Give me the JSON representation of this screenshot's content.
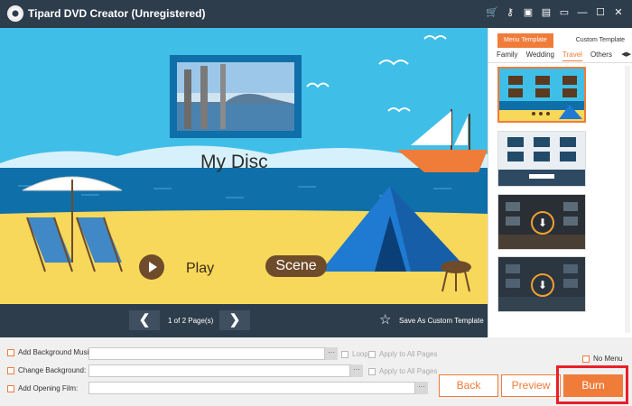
{
  "window": {
    "title": "Tipard DVD Creator (Unregistered)",
    "icons": [
      "cart-icon",
      "key-icon",
      "save-icon",
      "register-icon",
      "feedback-icon",
      "minimize-icon",
      "maximize-icon",
      "close-icon"
    ],
    "icon_glyphs": [
      "🛒",
      "⚷",
      "▣",
      "▤",
      "▭",
      "—",
      "☐",
      "✕"
    ]
  },
  "preview": {
    "disc_title": "My Disc",
    "play_label": "Play",
    "scene_label": "Scene"
  },
  "pager": {
    "prev": "❮",
    "next": "❯",
    "page_text": "1 of 2 Page(s)",
    "save_template": "Save As Custom Template"
  },
  "templates": {
    "tabs": [
      "Menu Template",
      "Custom Template"
    ],
    "active_tab": "Menu Template",
    "categories": [
      "Family",
      "Wedding",
      "Travel",
      "Others"
    ],
    "active_category": "Travel",
    "arrows": "◀▶"
  },
  "options": {
    "bg_music": "Add Background Music:",
    "change_bg": "Change Background:",
    "opening_film": "Add Opening Film:",
    "loop": "Loop",
    "apply_all_1": "Apply to All Pages",
    "apply_all_2": "Apply to All Pages",
    "dots": "···",
    "no_menu": "No Menu"
  },
  "buttons": {
    "back": "Back",
    "preview": "Preview",
    "burn": "Burn"
  },
  "colors": {
    "accent": "#f07c3a",
    "titlebar": "#2e3d4c",
    "highlight": "#e8202a"
  }
}
